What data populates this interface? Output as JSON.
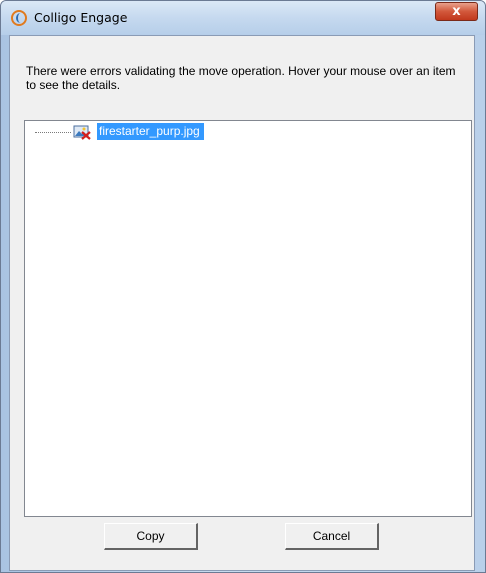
{
  "window": {
    "title": "Colligo Engage",
    "app_icon": "colligo-logo-icon",
    "close_icon": "close-x-icon",
    "close_glyph": "x"
  },
  "dialog": {
    "message": "There were errors validating the move operation. Hover your mouse over an item to see the details.",
    "tree": {
      "items": [
        {
          "label": "firestarter_purp.jpg",
          "icon": "image-file-error-icon",
          "selected": true
        }
      ]
    },
    "buttons": {
      "copy_label": "Copy",
      "cancel_label": "Cancel"
    }
  },
  "colors": {
    "selection": "#3399ff",
    "close_button": "#c1381d"
  }
}
